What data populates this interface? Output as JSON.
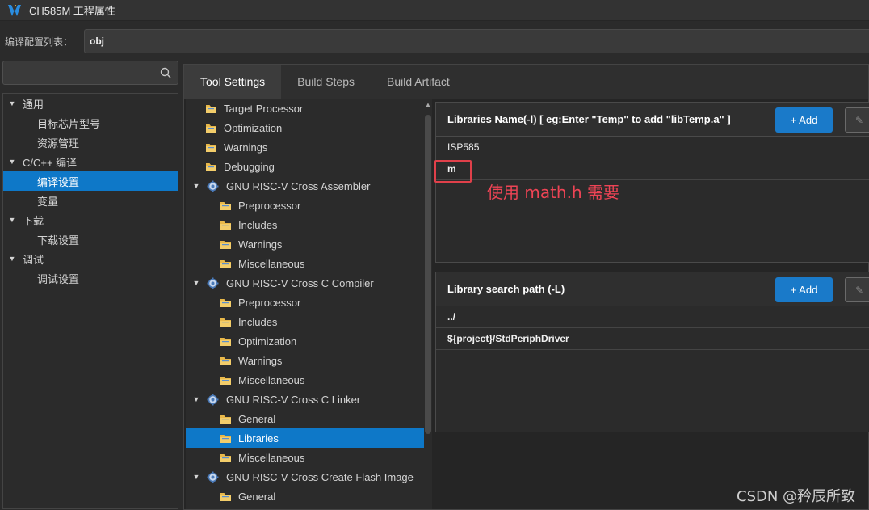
{
  "window": {
    "title": "CH585M 工程属性",
    "logo": "mounriver-logo-icon"
  },
  "config": {
    "label": "编译配置列表：",
    "value": "obj"
  },
  "search": {
    "icon": "search-icon"
  },
  "left_tree": [
    {
      "label": "通用",
      "level": 0,
      "expanded": true
    },
    {
      "label": "目标芯片型号",
      "level": 1
    },
    {
      "label": "资源管理",
      "level": 1
    },
    {
      "label": "C/C++ 编译",
      "level": 0,
      "expanded": true
    },
    {
      "label": "编译设置",
      "level": 1,
      "selected": true
    },
    {
      "label": "变量",
      "level": 1
    },
    {
      "label": "下载",
      "level": 0,
      "expanded": true
    },
    {
      "label": "下载设置",
      "level": 1
    },
    {
      "label": "调试",
      "level": 0,
      "expanded": true
    },
    {
      "label": "调试设置",
      "level": 1
    }
  ],
  "tabs": [
    {
      "label": "Tool Settings",
      "active": true
    },
    {
      "label": "Build Steps",
      "active": false
    },
    {
      "label": "Build Artifact",
      "active": false
    }
  ],
  "tool_tree": [
    {
      "label": "Target Processor",
      "type": "folder",
      "level": 0
    },
    {
      "label": "Optimization",
      "type": "folder",
      "level": 0
    },
    {
      "label": "Warnings",
      "type": "folder",
      "level": 0
    },
    {
      "label": "Debugging",
      "type": "folder",
      "level": 0
    },
    {
      "label": "GNU RISC-V Cross Assembler",
      "type": "gear",
      "level": 0
    },
    {
      "label": "Preprocessor",
      "type": "folder",
      "level": 1
    },
    {
      "label": "Includes",
      "type": "folder",
      "level": 1
    },
    {
      "label": "Warnings",
      "type": "folder",
      "level": 1
    },
    {
      "label": "Miscellaneous",
      "type": "folder",
      "level": 1
    },
    {
      "label": "GNU RISC-V Cross C Compiler",
      "type": "gear",
      "level": 0
    },
    {
      "label": "Preprocessor",
      "type": "folder",
      "level": 1
    },
    {
      "label": "Includes",
      "type": "folder",
      "level": 1
    },
    {
      "label": "Optimization",
      "type": "folder",
      "level": 1
    },
    {
      "label": "Warnings",
      "type": "folder",
      "level": 1
    },
    {
      "label": "Miscellaneous",
      "type": "folder",
      "level": 1
    },
    {
      "label": "GNU RISC-V Cross C Linker",
      "type": "gear",
      "level": 0
    },
    {
      "label": "General",
      "type": "folder",
      "level": 1
    },
    {
      "label": "Libraries",
      "type": "folder",
      "level": 1,
      "selected": true
    },
    {
      "label": "Miscellaneous",
      "type": "folder",
      "level": 1
    },
    {
      "label": "GNU RISC-V Cross Create Flash Image",
      "type": "gear",
      "level": 0
    },
    {
      "label": "General",
      "type": "folder",
      "level": 1
    }
  ],
  "libraries": {
    "header": "Libraries Name(-l) [ eg:Enter \"Temp\" to add \"libTemp.a\" ]",
    "add_label": "+ Add",
    "items": [
      "ISP585",
      "m"
    ]
  },
  "search_paths": {
    "header": "Library search path (-L)",
    "add_label": "+ Add",
    "items": [
      "../",
      "${project}/StdPeriphDriver"
    ]
  },
  "annotation": "使用 math.h 需要",
  "watermark": "CSDN @矜辰所致",
  "colors": {
    "accent": "#0e78c8",
    "annotation": "#ee4455"
  }
}
